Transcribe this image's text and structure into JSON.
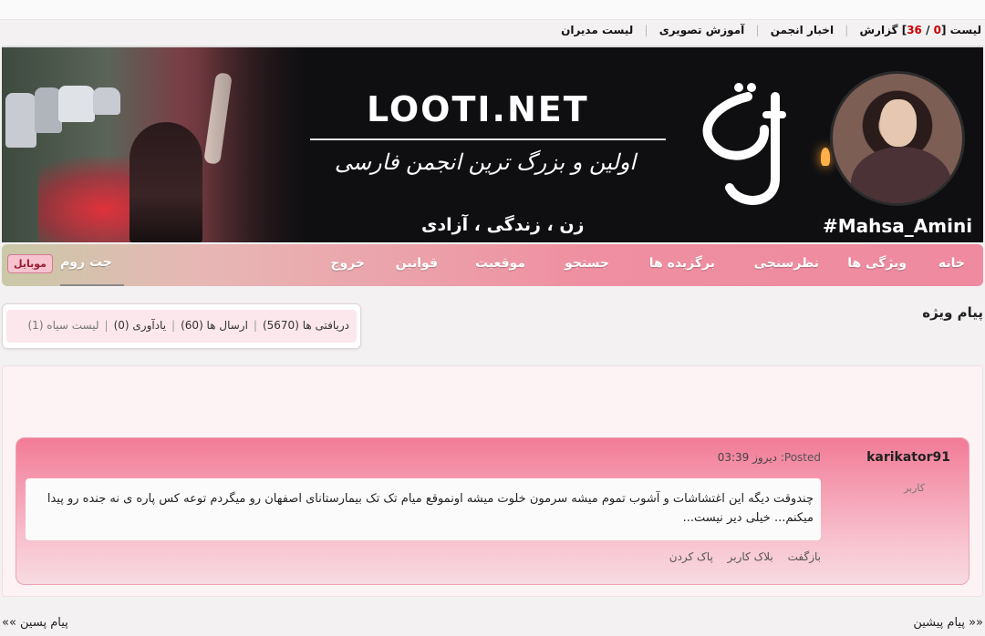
{
  "toplinks": {
    "list_label": "لیست",
    "list_open": "[",
    "list_count_a": "0",
    "list_slash": " / ",
    "list_count_b": "36",
    "list_close": "]",
    "report": "گزارش",
    "forum_news": "اخبار انجمن",
    "video_tutorial": "آموزش تصویری",
    "admins_list": "لیست مدیران"
  },
  "banner": {
    "site_name": "LOOTI.NET",
    "tagline": "اولین و بزرگ ترین انجمن فارسی",
    "slogan": "زن ، زندگی ، آزادی",
    "hashtag": "#Mahsa_Amini",
    "logo_text": "لوتی"
  },
  "nav": {
    "home": "خانه",
    "features": "ویژگی ها",
    "polls": "نظرسنجی",
    "favorites": "برگزیده ها",
    "search": "جستجو",
    "location": "موقعیت",
    "rules": "قوانین",
    "logout": "خروج",
    "chat": "چت روم",
    "mobile": "موبایل"
  },
  "pm": {
    "title": "پیام ویژه",
    "inbox": "دریافتی ها (5670)",
    "sent": "ارسال ها (60)",
    "reminders": "یادآوری (0)",
    "blacklist": "لیست سیاه (1)"
  },
  "message": {
    "author": "karikator91",
    "role": "کاربر",
    "posted_label": "Posted:",
    "posted_time": "دیروز 03:39",
    "body": "چندوقت دیگه این اغتشاشات و آشوب تموم میشه سرمون خلوت میشه اونموقع میام تک تک بیمارستانای اصفهان رو میگردم توعه کس پاره ی نه جنده رو پیدا میکنم... خیلی دیر نیست...",
    "reply": "بازگفت",
    "block_user": "بلاک کاربر",
    "delete": "پاک کردن"
  },
  "pager": {
    "prev": "«« پیام پیشین",
    "next": "پیام پسین »»"
  },
  "colors": {
    "nav_pink": "#ef8aa0",
    "card_pink": "#f27b96",
    "count_red": "#cc0000"
  }
}
